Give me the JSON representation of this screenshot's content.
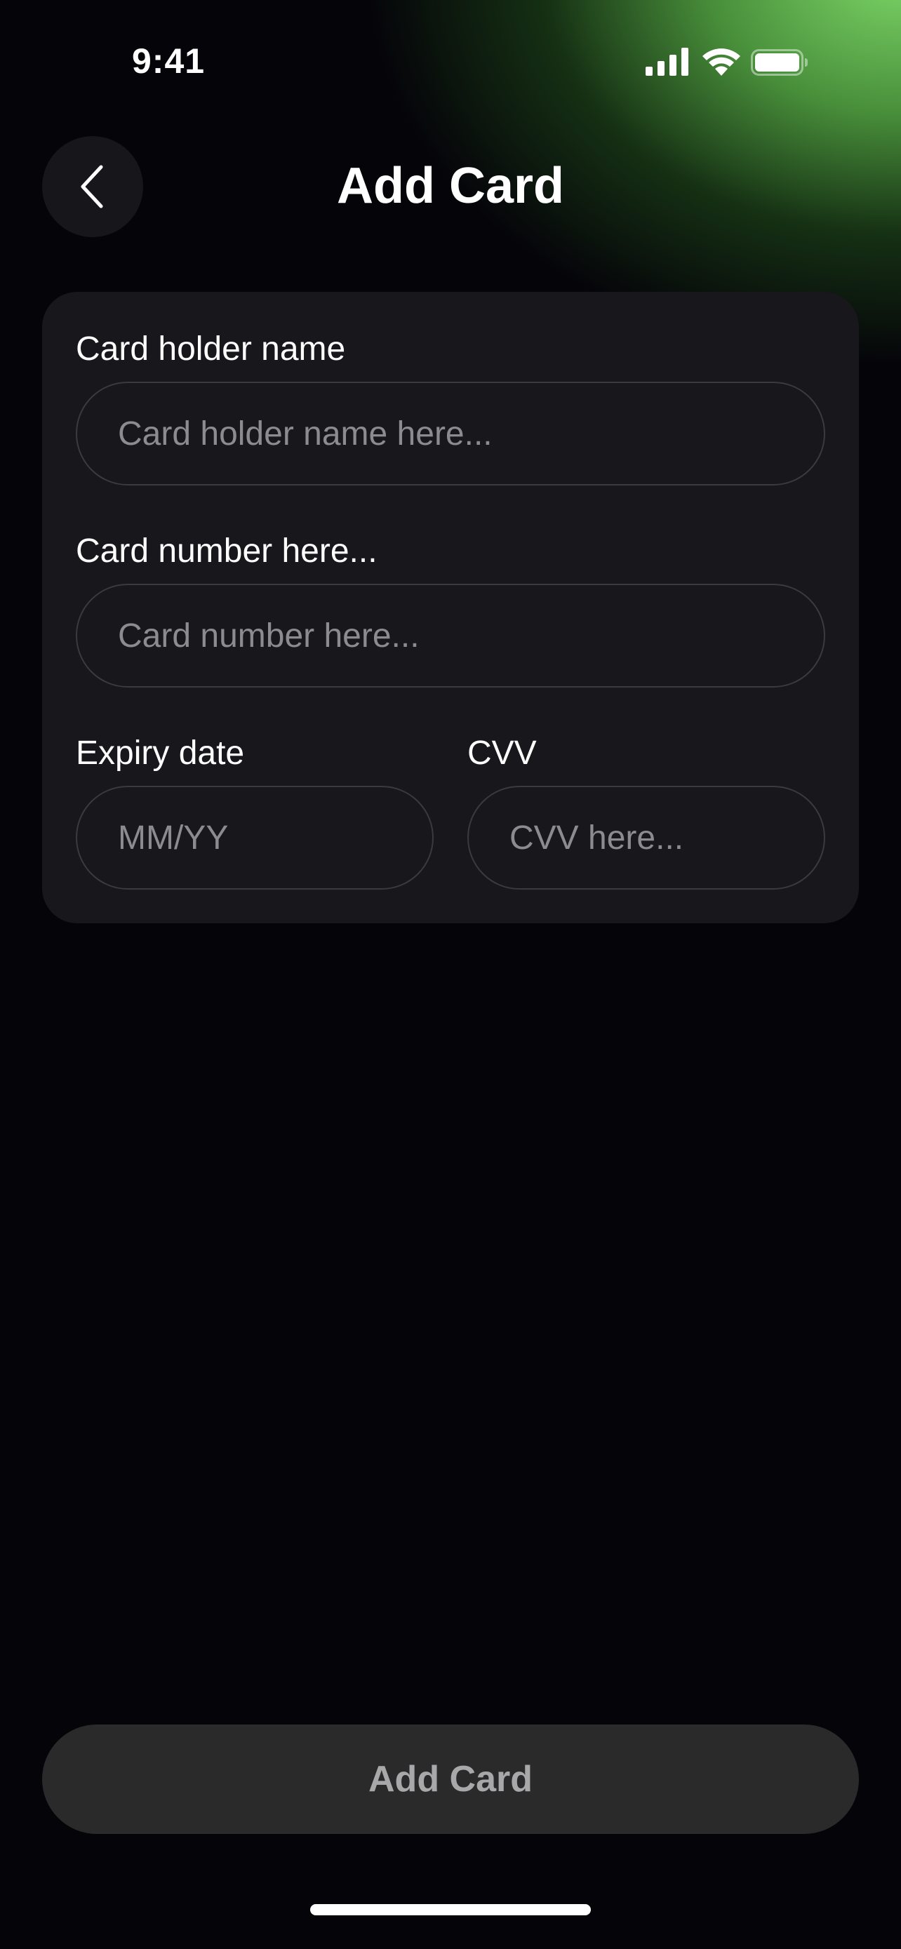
{
  "status_bar": {
    "time": "9:41",
    "icons": [
      "signal-icon",
      "wifi-icon",
      "battery-icon"
    ]
  },
  "header": {
    "title": "Add Card",
    "back_icon": "chevron-left-icon"
  },
  "form": {
    "card_holder": {
      "label": "Card holder name",
      "placeholder": "Card holder name here...",
      "value": ""
    },
    "card_number": {
      "label": "Card number here...",
      "placeholder": "Card number here...",
      "value": ""
    },
    "expiry": {
      "label": "Expiry date",
      "placeholder": "MM/YY",
      "value": ""
    },
    "cvv": {
      "label": "CVV",
      "placeholder": "CVV here...",
      "value": ""
    }
  },
  "footer": {
    "submit_label": "Add Card"
  },
  "colors": {
    "background": "#050409",
    "card_surface": "#17171c",
    "accent_green": "#7dd668",
    "button_disabled": "#2a2a2b",
    "button_text_disabled": "#a8a8ab",
    "placeholder": "#8b8b90"
  }
}
